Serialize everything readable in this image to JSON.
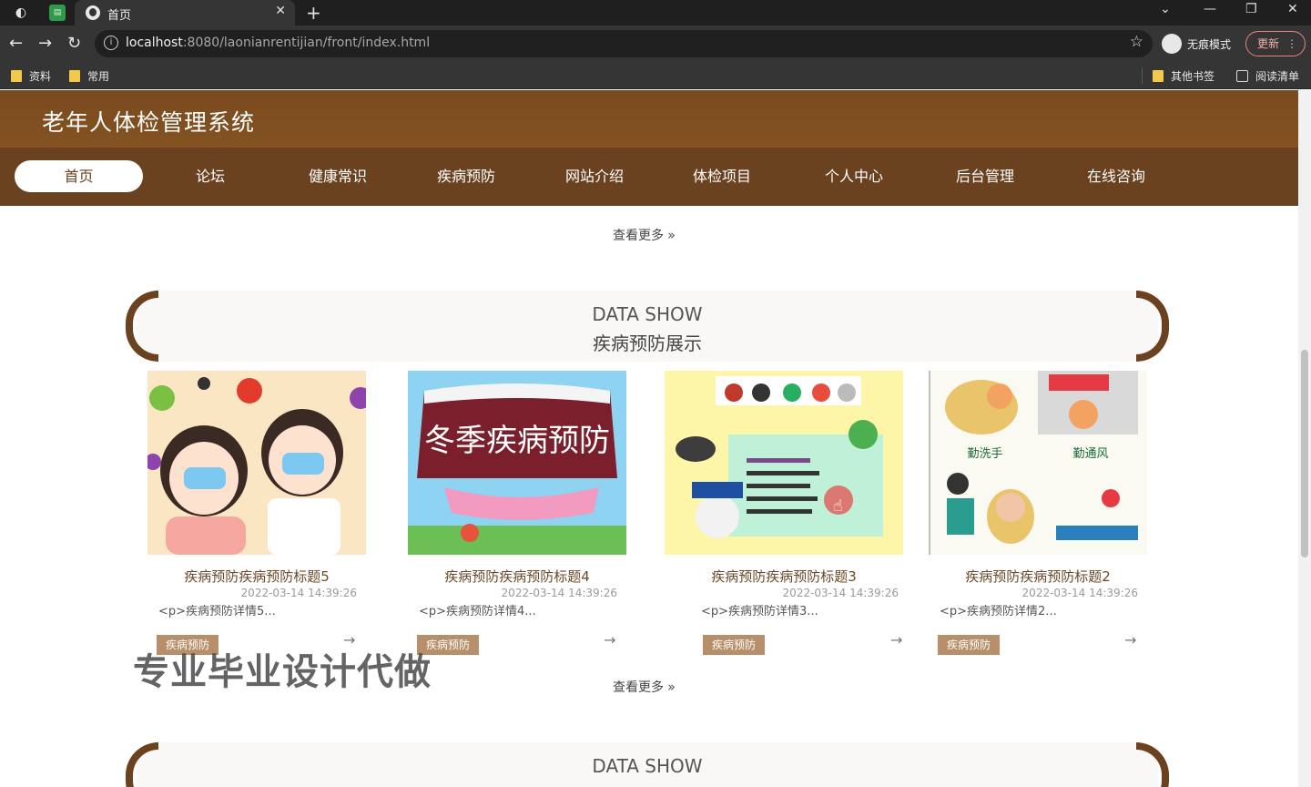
{
  "browser": {
    "tab_title": "首页",
    "new_tab_symbol": "+",
    "close_symbol": "✕",
    "url_host": "localhost",
    "url_rest": ":8080/laonianrentijian/front/index.html",
    "incognito_label": "无痕模式",
    "update_label": "更新",
    "bookmarks": [
      "资料",
      "常用"
    ],
    "bookmarks_right": [
      "其他书签",
      "阅读清单"
    ]
  },
  "site": {
    "title": "老年人体检管理系统",
    "nav": [
      "首页",
      "论坛",
      "健康常识",
      "疾病预防",
      "网站介绍",
      "体检项目",
      "个人中心",
      "后台管理",
      "在线咨询"
    ],
    "active_nav": "首页"
  },
  "more_label": "查看更多",
  "section1": {
    "en": "DATA SHOW",
    "cn": "疾病预防展示",
    "cards": [
      {
        "title": "疾病预防疾病预防标题5",
        "date": "2022-03-14 14:39:26",
        "desc": "<p>疾病预防详情5...",
        "tag": "疾病预防",
        "arrow": "→",
        "image": "children-with-masks-and-viruses"
      },
      {
        "title": "疾病预防疾病预防标题4",
        "date": "2022-03-14 14:39:26",
        "desc": "<p>疾病预防详情4...",
        "tag": "疾病预防",
        "arrow": "→",
        "image": "winter-disease-prevention-banner",
        "image_text": "冬季疾病预防"
      },
      {
        "title": "疾病预防疾病预防标题3",
        "date": "2022-03-14 14:39:26",
        "desc": "<p>疾病预防详情3...",
        "tag": "疾病预防",
        "arrow": "→",
        "image": "prevention-poster-doctor"
      },
      {
        "title": "疾病预防疾病预防标题2",
        "date": "2022-03-14 14:39:26",
        "desc": "<p>疾病预防详情2...",
        "tag": "疾病预防",
        "arrow": "→",
        "image": "hand-washing-ventilation-poster",
        "image_labels": [
          "勤洗手",
          "勤通风"
        ]
      }
    ]
  },
  "section2": {
    "en": "DATA SHOW"
  },
  "watermark": "专业毕业设计代做",
  "colors": {
    "brand": "#6b4220",
    "header": "#845321",
    "tag": "#b78f6a"
  }
}
